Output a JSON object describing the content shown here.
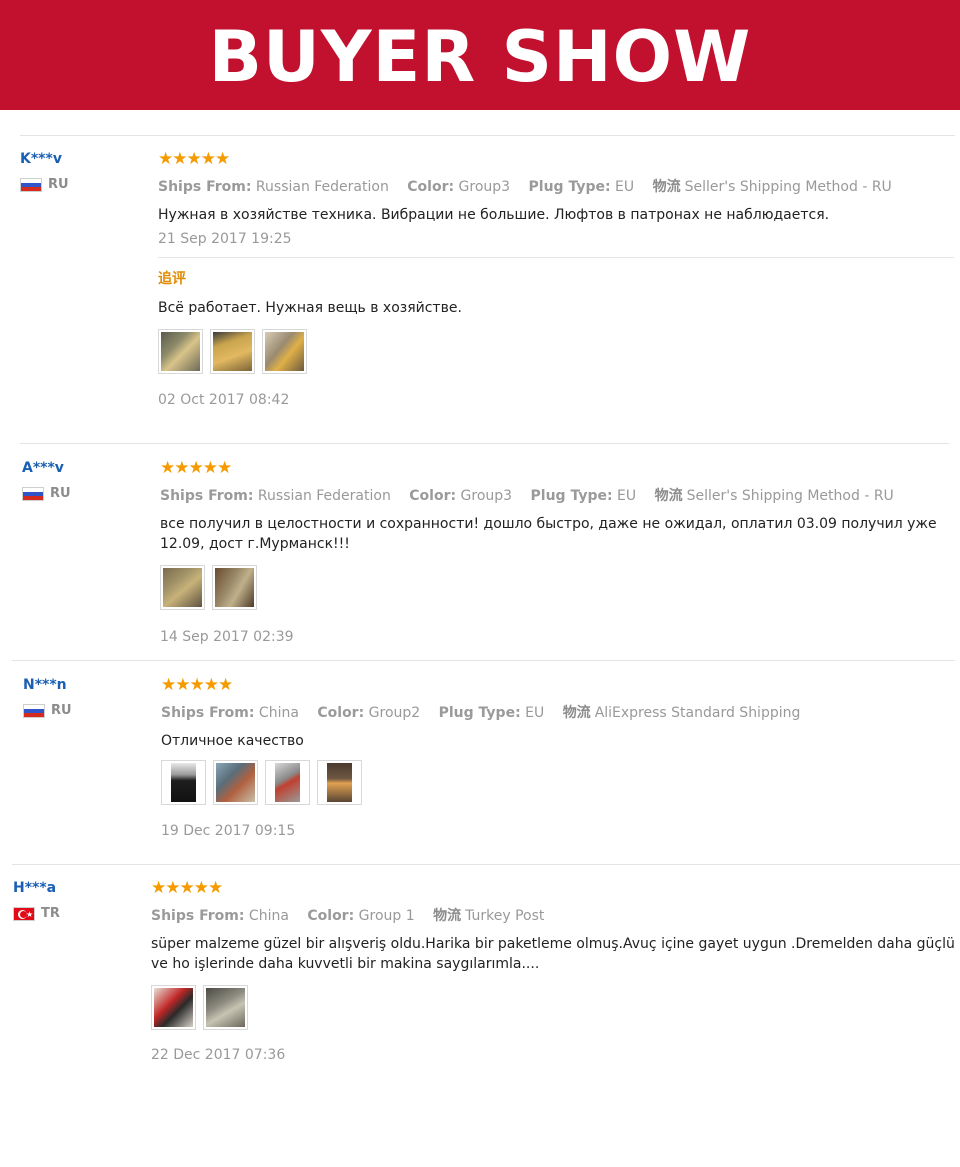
{
  "banner": {
    "title": "BUYER SHOW"
  },
  "labels": {
    "ships_from": "Ships From:",
    "color": "Color:",
    "plug_type": "Plug Type:",
    "shipping": "物流"
  },
  "reviews": [
    {
      "user": "K***v",
      "country": "RU",
      "stars": "★★★★★",
      "ships_from": "Russian Federation",
      "color": "Group3",
      "plug_type": "EU",
      "shipping": "Seller's Shipping Method - RU",
      "text": "Нужная в хозяйстве техника. Вибрации не большие. Люфтов в патронах не наблюдается.",
      "date": "21 Sep 2017 19:25",
      "followup": {
        "label": "追评",
        "text": "Всё работает. Нужная вещь в хозяйстве.",
        "date": "02 Oct 2017 08:42"
      }
    },
    {
      "user": "A***v",
      "country": "RU",
      "stars": "★★★★★",
      "ships_from": "Russian Federation",
      "color": "Group3",
      "plug_type": "EU",
      "shipping": "Seller's Shipping Method - RU",
      "text": "все получил в целостности и сохранности! дошло быстро, даже не ожидал, оплатил 03.09 получил уже 12.09, дост г.Мурманск!!!",
      "date": "14 Sep 2017 02:39"
    },
    {
      "user": "N***n",
      "country": "RU",
      "stars": "★★★★★",
      "ships_from": "China",
      "color": "Group2",
      "plug_type": "EU",
      "shipping": "AliExpress Standard Shipping",
      "text": "Отличное качество",
      "date": "19 Dec 2017 09:15"
    },
    {
      "user": "H***a",
      "country": "TR",
      "stars": "★★★★★",
      "ships_from": "China",
      "color": "Group 1",
      "shipping": "Turkey Post",
      "text": "süper malzeme güzel bir alışveriş oldu.Harika bir paketleme olmuş.Avuç içine gayet uygun .Dremelden daha güçlü ve ho işlerinde daha kuvvetli bir makina saygılarımla....",
      "date": "22 Dec 2017 07:36"
    }
  ],
  "colors": {
    "banner": "#c2112f",
    "stars": "#f59b00",
    "username": "#1a5fb4",
    "followup": "#e08a00"
  }
}
